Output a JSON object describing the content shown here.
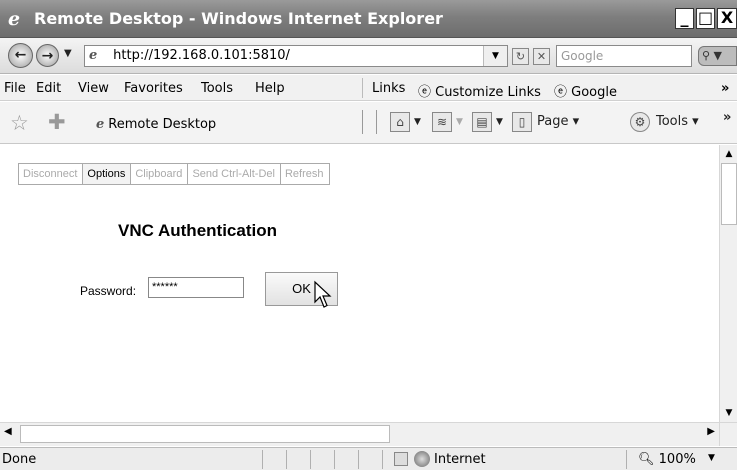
{
  "window": {
    "title": "Remote Desktop - Windows Internet Explorer",
    "minimize": "_",
    "maximize": "□",
    "close": "X"
  },
  "address_bar": {
    "url": "http://192.168.0.101:5810/",
    "search_placeholder": "Google",
    "back_glyph": "←",
    "forward_glyph": "→"
  },
  "menu": {
    "items": [
      "File",
      "Edit",
      "View",
      "Favorites",
      "Tools",
      "Help"
    ],
    "links_label": "Links",
    "links": [
      "Customize Links",
      "Google"
    ],
    "overflow": "»"
  },
  "favorites_bar": {
    "tab_title": "Remote Desktop",
    "page_label": "Page",
    "tools_label": "Tools",
    "overflow": "»"
  },
  "vnc": {
    "toolbar": [
      {
        "label": "Disconnect",
        "enabled": false
      },
      {
        "label": "Options",
        "enabled": true
      },
      {
        "label": "Clipboard",
        "enabled": false
      },
      {
        "label": "Send Ctrl-Alt-Del",
        "enabled": false
      },
      {
        "label": "Refresh",
        "enabled": false
      }
    ],
    "heading": "VNC Authentication",
    "password_label": "Password:",
    "password_value": "******",
    "ok_label": "OK"
  },
  "status_bar": {
    "status": "Done",
    "zone": "Internet",
    "zoom": "100%"
  }
}
